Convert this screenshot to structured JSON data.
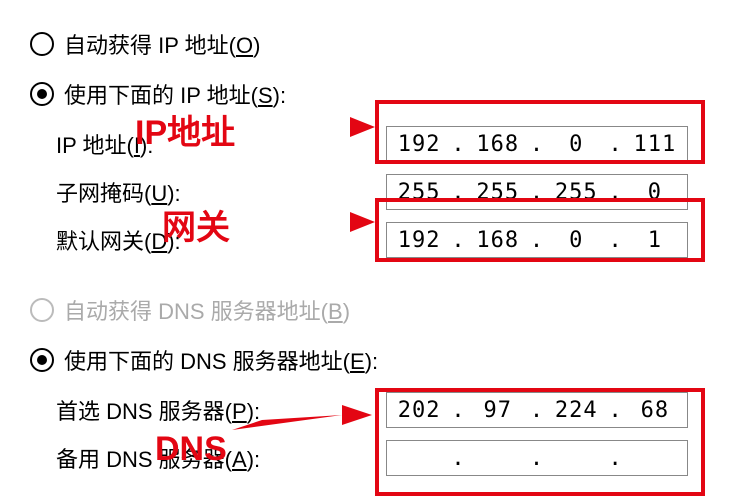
{
  "ip_section": {
    "auto": {
      "label_pre": "自动获得 IP 地址(",
      "label_u": "O",
      "label_post": ")",
      "checked": false,
      "disabled": false
    },
    "manual": {
      "label_pre": "使用下面的 IP 地址(",
      "label_u": "S",
      "label_post": "):",
      "checked": true
    },
    "fields": {
      "ip": {
        "label_pre": "IP 地址(",
        "label_u": "I",
        "label_post": "):",
        "value": [
          "192",
          "168",
          "0",
          "111"
        ]
      },
      "mask": {
        "label_pre": "子网掩码(",
        "label_u": "U",
        "label_post": "):",
        "value": [
          "255",
          "255",
          "255",
          "0"
        ]
      },
      "gateway": {
        "label_pre": "默认网关(",
        "label_u": "D",
        "label_post": "):",
        "value": [
          "192",
          "168",
          "0",
          "1"
        ]
      }
    }
  },
  "dns_section": {
    "auto": {
      "label_pre": "自动获得 DNS 服务器地址(",
      "label_u": "B",
      "label_post": ")",
      "checked": false,
      "disabled": true
    },
    "manual": {
      "label_pre": "使用下面的 DNS 服务器地址(",
      "label_u": "E",
      "label_post": "):",
      "checked": true
    },
    "fields": {
      "primary": {
        "label_pre": "首选 DNS 服务器(",
        "label_u": "P",
        "label_post": "):",
        "value": [
          "202",
          "97",
          "224",
          "68"
        ]
      },
      "alternate": {
        "label_pre": "备用 DNS 服务器(",
        "label_u": "A",
        "label_post": "):",
        "value": [
          "",
          "",
          "",
          ""
        ]
      }
    }
  },
  "annotations": {
    "ip": "IP地址",
    "gateway": "网关",
    "dns": "DNS"
  }
}
